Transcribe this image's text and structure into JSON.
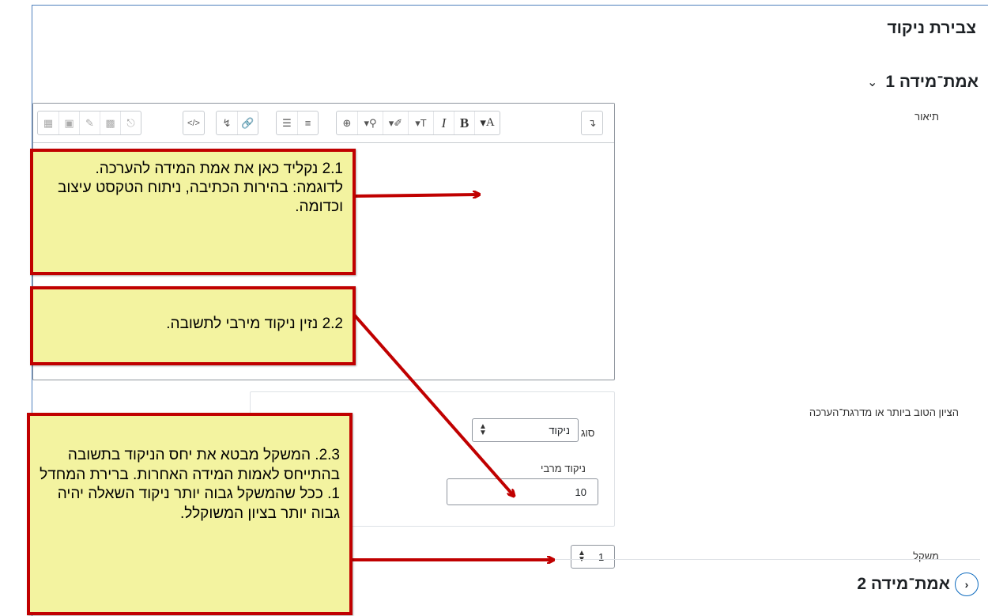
{
  "page": {
    "heading": "צבירת ניקוד"
  },
  "criterion1": {
    "title": "אמת־מידה 1",
    "description_label": "תיאור",
    "best_grade_label": "הציון הטוב ביותר או מדרגת־הערכה",
    "type_label": "סוג",
    "type_value": "ניקוד",
    "max_points_label": "ניקוד מרבי",
    "max_points_value": "10",
    "weight_label": "משקל",
    "weight_value": "1"
  },
  "criterion2": {
    "title": "אמת־מידה 2"
  },
  "toolbar": {
    "italic": "I",
    "bold": "B",
    "font_color": "A"
  },
  "callouts": {
    "c1": "2.1 נקליד כאן את אמת המידה להערכה. לדוגמה: בהירות הכתיבה, ניתוח הטקסט עיצוב וכדומה.",
    "c2": "2.2 נזין ניקוד מירבי לתשובה.",
    "c3": "2.3. המשקל מבטא את יחס הניקוד בתשובה בהתייחס לאמות המידה האחרות. ברירת המחדל 1. ככל שהמשקל גבוה יותר ניקוד השאלה יהיה גבוה יותר בציון המשוקלל."
  },
  "colors": {
    "callout_bg": "#f3f3a0",
    "callout_border": "#c00000",
    "arrow": "#c00000",
    "frame": "#4f81bd"
  }
}
